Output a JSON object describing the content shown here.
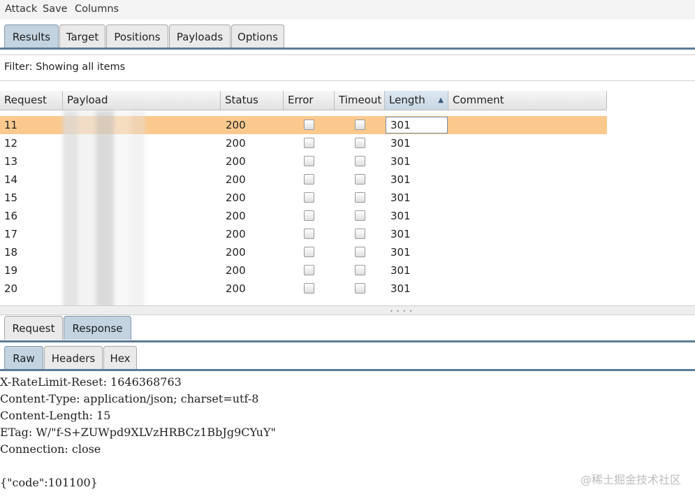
{
  "menu": [
    "Attack",
    "Save",
    "Columns"
  ],
  "main_tabs": [
    "Results",
    "Target",
    "Positions",
    "Payloads",
    "Options"
  ],
  "filter": "Filter: Showing all items",
  "table": {
    "columns": [
      "Request",
      "Payload",
      "Status",
      "Error",
      "Timeout",
      "Length",
      "Comment"
    ],
    "sort_indicator": "▲",
    "rows": [
      {
        "request": "11",
        "status": "200",
        "length": "301",
        "selected": true
      },
      {
        "request": "12",
        "status": "200",
        "length": "301"
      },
      {
        "request": "13",
        "status": "200",
        "length": "301"
      },
      {
        "request": "14",
        "status": "200",
        "length": "301"
      },
      {
        "request": "15",
        "status": "200",
        "length": "301"
      },
      {
        "request": "16",
        "status": "200",
        "length": "301"
      },
      {
        "request": "17",
        "status": "200",
        "length": "301"
      },
      {
        "request": "18",
        "status": "200",
        "length": "301"
      },
      {
        "request": "19",
        "status": "200",
        "length": "301"
      },
      {
        "request": "20",
        "status": "200",
        "length": "301"
      }
    ]
  },
  "detail_tabs": [
    "Request",
    "Response"
  ],
  "view_tabs": [
    "Raw",
    "Headers",
    "Hex"
  ],
  "response_lines": [
    "X-RateLimit-Reset: 1646368763",
    "Content-Type: application/json; charset=utf-8",
    "Content-Length: 15",
    "ETag: W/\"f-S+ZUWpd9XLVzHRBCz1BbJg9CYuY\"",
    "Connection: close",
    "",
    "{\"code\":101100}"
  ],
  "watermark": "@稀土掘金技术社区",
  "colors": {
    "selected_row": "#fbc98e",
    "active_tab": "#c3d3e0",
    "tab_rule": "#5d7c96"
  }
}
